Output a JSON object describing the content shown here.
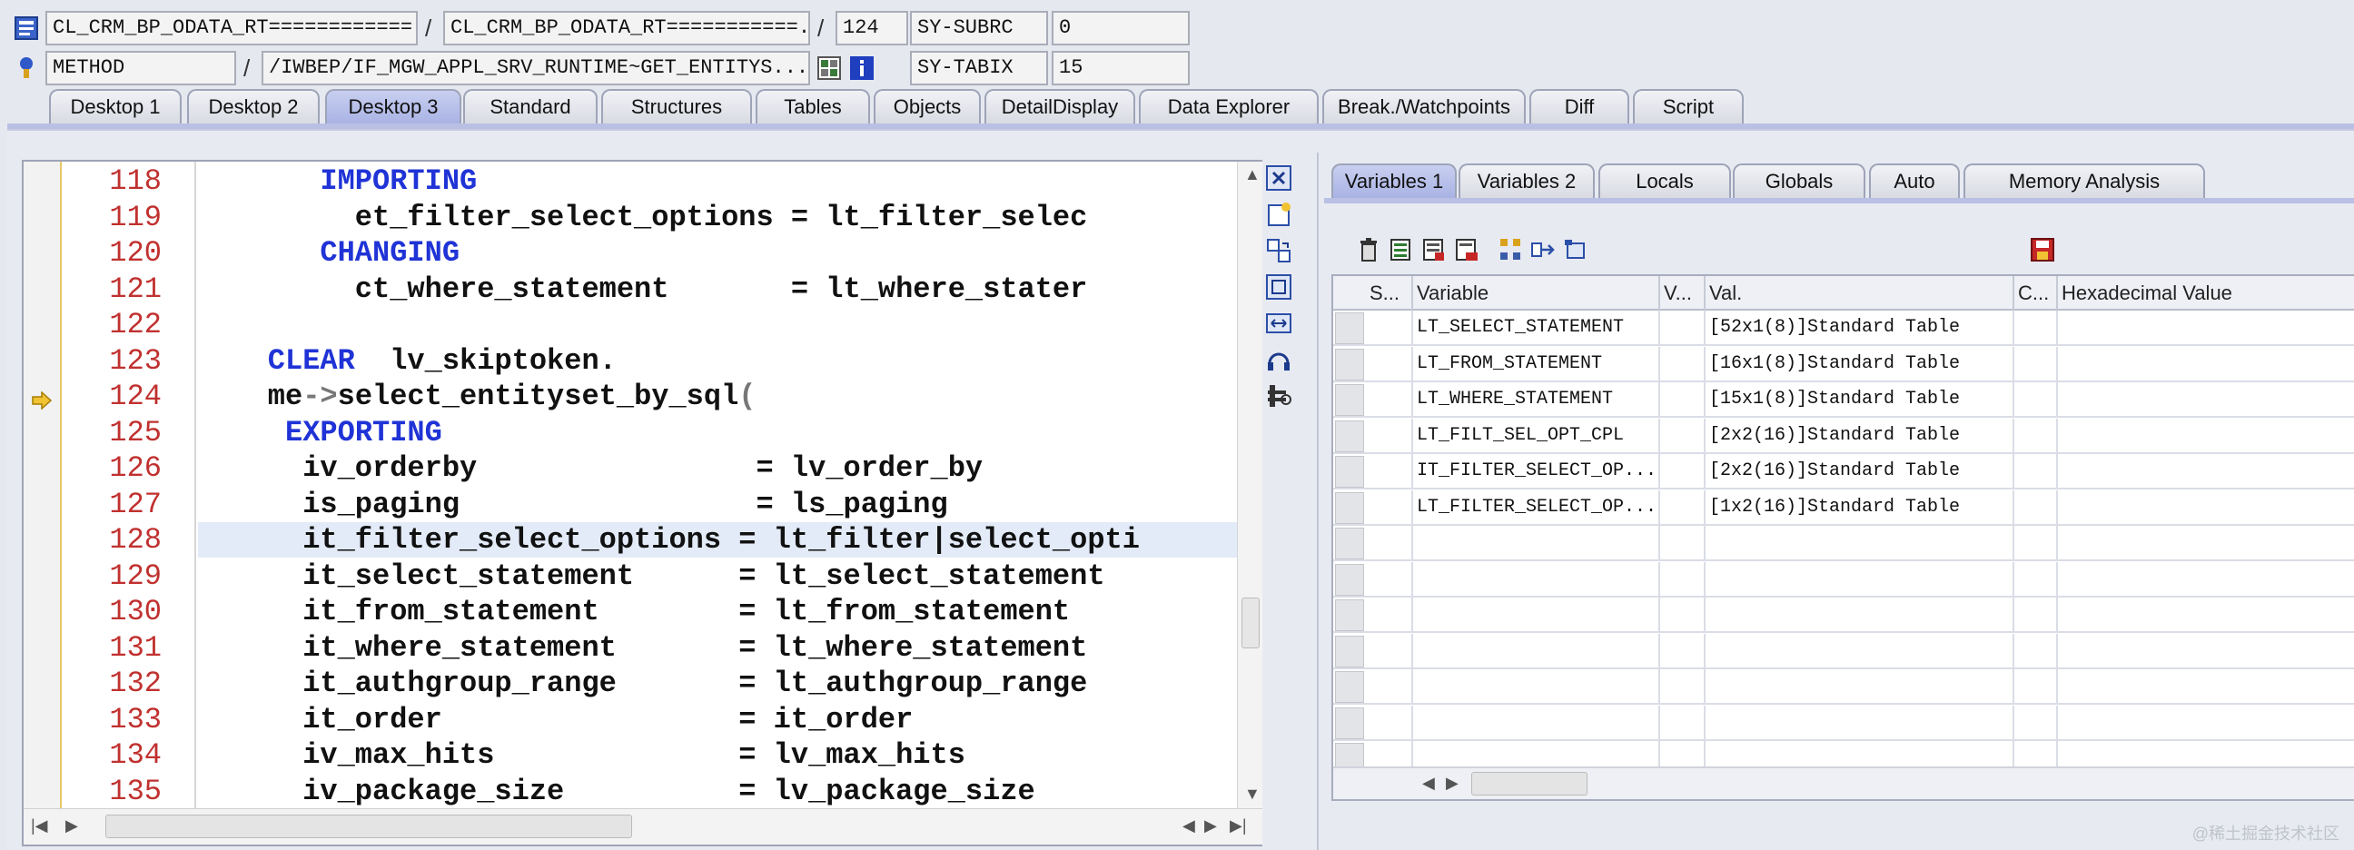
{
  "info_rows": {
    "row1": {
      "program": "CL_CRM_BP_ODATA_RT============...",
      "include": "CL_CRM_BP_ODATA_RT===========...",
      "line": "124",
      "sysvar_name": "SY-SUBRC",
      "sysvar_value": "0"
    },
    "row2": {
      "event_type": "METHOD",
      "event_name": "/IWBEP/IF_MGW_APPL_SRV_RUNTIME~GET_ENTITYS...",
      "sysvar_name": "SY-TABIX",
      "sysvar_value": "15"
    },
    "separator": "/"
  },
  "tabs": [
    {
      "label": "Desktop 1",
      "active": false
    },
    {
      "label": "Desktop 2",
      "active": false
    },
    {
      "label": "Desktop 3",
      "active": true
    },
    {
      "label": "Standard",
      "active": false
    },
    {
      "label": "Structures",
      "active": false
    },
    {
      "label": "Tables",
      "active": false
    },
    {
      "label": "Objects",
      "active": false
    },
    {
      "label": "DetailDisplay",
      "active": false
    },
    {
      "label": "Data Explorer",
      "active": false
    },
    {
      "label": "Break./Watchpoints",
      "active": false
    },
    {
      "label": "Diff",
      "active": false
    },
    {
      "label": "Script",
      "active": false
    }
  ],
  "editor": {
    "current_line": 124,
    "highlighted_line": 128,
    "lines": [
      {
        "num": "118",
        "indent": 7,
        "parts": [
          {
            "t": "IMPORTING",
            "kw": true
          }
        ]
      },
      {
        "num": "119",
        "indent": 9,
        "parts": [
          {
            "t": "et_filter_select_options = lt_filter_selec",
            "kw": false
          }
        ]
      },
      {
        "num": "120",
        "indent": 7,
        "parts": [
          {
            "t": "CHANGING",
            "kw": true
          }
        ]
      },
      {
        "num": "121",
        "indent": 9,
        "parts": [
          {
            "t": "ct_where_statement       = lt_where_stater",
            "kw": false
          }
        ]
      },
      {
        "num": "122",
        "indent": 0,
        "parts": []
      },
      {
        "num": "123",
        "indent": 4,
        "parts": [
          {
            "t": "CLEAR",
            "kw": true
          },
          {
            "t": "  lv_skiptoken.",
            "kw": false
          }
        ]
      },
      {
        "num": "124",
        "indent": 4,
        "parts": [
          {
            "t": "me",
            "kw": false
          },
          {
            "t": "->",
            "op": true
          },
          {
            "t": "select_entityset_by_sql",
            "kw": false
          },
          {
            "t": "(",
            "op": true
          }
        ]
      },
      {
        "num": "125",
        "indent": 5,
        "parts": [
          {
            "t": "EXPORTING",
            "kw": true
          }
        ]
      },
      {
        "num": "126",
        "indent": 6,
        "parts": [
          {
            "t": "iv_orderby                = lv_order_by",
            "kw": false
          }
        ]
      },
      {
        "num": "127",
        "indent": 6,
        "parts": [
          {
            "t": "is_paging                 = ls_paging",
            "kw": false
          }
        ]
      },
      {
        "num": "128",
        "indent": 6,
        "parts": [
          {
            "t": "it_filter_select_options = lt_filter|select_opti",
            "kw": false
          }
        ]
      },
      {
        "num": "129",
        "indent": 6,
        "parts": [
          {
            "t": "it_select_statement      = lt_select_statement",
            "kw": false
          }
        ]
      },
      {
        "num": "130",
        "indent": 6,
        "parts": [
          {
            "t": "it_from_statement        = lt_from_statement",
            "kw": false
          }
        ]
      },
      {
        "num": "131",
        "indent": 6,
        "parts": [
          {
            "t": "it_where_statement       = lt_where_statement",
            "kw": false
          }
        ]
      },
      {
        "num": "132",
        "indent": 6,
        "parts": [
          {
            "t": "it_authgroup_range       = lt_authgroup_range",
            "kw": false
          }
        ]
      },
      {
        "num": "133",
        "indent": 6,
        "parts": [
          {
            "t": "it_order                 = it_order",
            "kw": false
          }
        ]
      },
      {
        "num": "134",
        "indent": 6,
        "parts": [
          {
            "t": "iv_max_hits              = lv_max_hits",
            "kw": false
          }
        ]
      },
      {
        "num": "135",
        "indent": 6,
        "parts": [
          {
            "t": "iv_package_size          = lv_package_size",
            "kw": false
          }
        ]
      }
    ]
  },
  "vertical_toolbar": [
    "close-icon",
    "new-tool-icon",
    "swap-tool-icon",
    "maximize-icon",
    "fit-width-icon",
    "headset-icon",
    "services-icon"
  ],
  "right_panel": {
    "tabs": [
      {
        "label": "Variables 1",
        "active": true
      },
      {
        "label": "Variables 2",
        "active": false
      },
      {
        "label": "Locals",
        "active": false
      },
      {
        "label": "Globals",
        "active": false
      },
      {
        "label": "Auto",
        "active": false
      },
      {
        "label": "Memory Analysis",
        "active": false
      }
    ],
    "toolbar_icons": [
      "delete-icon",
      "import-icon",
      "export-icon",
      "save-layout-icon",
      "hierarchy-icon",
      "transfer-icon",
      "open-icon",
      "save-icon"
    ],
    "columns": [
      "S...",
      "Variable",
      "V...",
      "Val.",
      "C...",
      "Hexadecimal Value"
    ],
    "rows": [
      {
        "variable": "LT_SELECT_STATEMENT",
        "value": "[52x1(8)]Standard Table"
      },
      {
        "variable": "LT_FROM_STATEMENT",
        "value": "[16x1(8)]Standard Table"
      },
      {
        "variable": "LT_WHERE_STATEMENT",
        "value": "[15x1(8)]Standard Table"
      },
      {
        "variable": "LT_FILT_SEL_OPT_CPL",
        "value": "[2x2(16)]Standard Table"
      },
      {
        "variable": "IT_FILTER_SELECT_OP...",
        "value": "[2x2(16)]Standard Table"
      },
      {
        "variable": "LT_FILTER_SELECT_OP...",
        "value": "[1x2(16)]Standard Table"
      }
    ],
    "empty_row_count": 7
  },
  "watermark": "@稀土掘金技术社区"
}
